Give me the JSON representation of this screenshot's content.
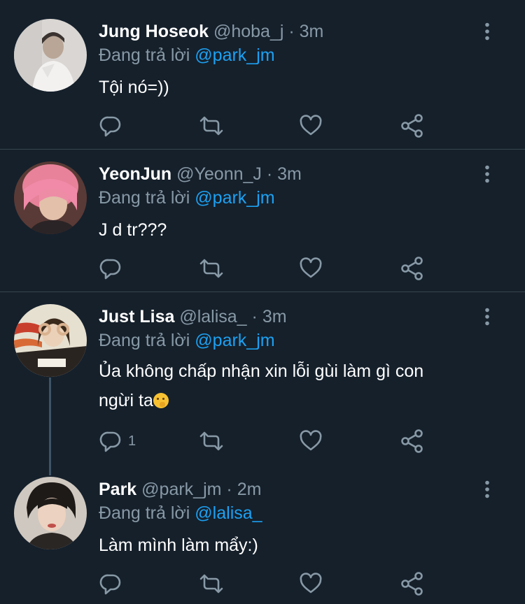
{
  "tweets": [
    {
      "name": "Jung Hoseok",
      "handle": "@hoba_j",
      "dot": "·",
      "time": "3m",
      "reply_prefix": "Đang trả lời",
      "reply_to": "@park_jm",
      "text": "Tội nó=))",
      "reply_count": "",
      "avatar_icon": "avatar-photo-hoseok"
    },
    {
      "name": "YeonJun",
      "handle": "@Yeonn_J",
      "dot": "·",
      "time": "3m",
      "reply_prefix": "Đang trả lời",
      "reply_to": "@park_jm",
      "text": "J d tr???",
      "reply_count": "",
      "avatar_icon": "avatar-photo-yeonjun"
    },
    {
      "name": "Just Lisa",
      "handle": "@lalisa_",
      "dot": "·",
      "time": "3m",
      "reply_prefix": "Đang trả lời",
      "reply_to": "@park_jm",
      "text_line1": "Ủa không chấp nhận xin lỗi gùi làm gì con",
      "text_line2": "ngừi ta",
      "text_emoji": "face-with-hand-over-mouth-emoji",
      "reply_count": "1",
      "avatar_icon": "avatar-photo-lisa"
    },
    {
      "name": "Park",
      "handle": "@park_jm",
      "dot": "·",
      "time": "2m",
      "reply_prefix": "Đang trả lời",
      "reply_to": "@lalisa_",
      "text": "Làm mình làm mẩy:)",
      "reply_count": "",
      "avatar_icon": "avatar-photo-park"
    }
  ],
  "action_icons": [
    "reply-icon",
    "retweet-icon",
    "like-icon",
    "share-icon"
  ],
  "menu_icon": "more-options-icon",
  "colors": {
    "background": "#15202b",
    "text": "#ffffff",
    "secondary": "#8899a6",
    "mention": "#1da1f2",
    "divider": "#38444d"
  }
}
